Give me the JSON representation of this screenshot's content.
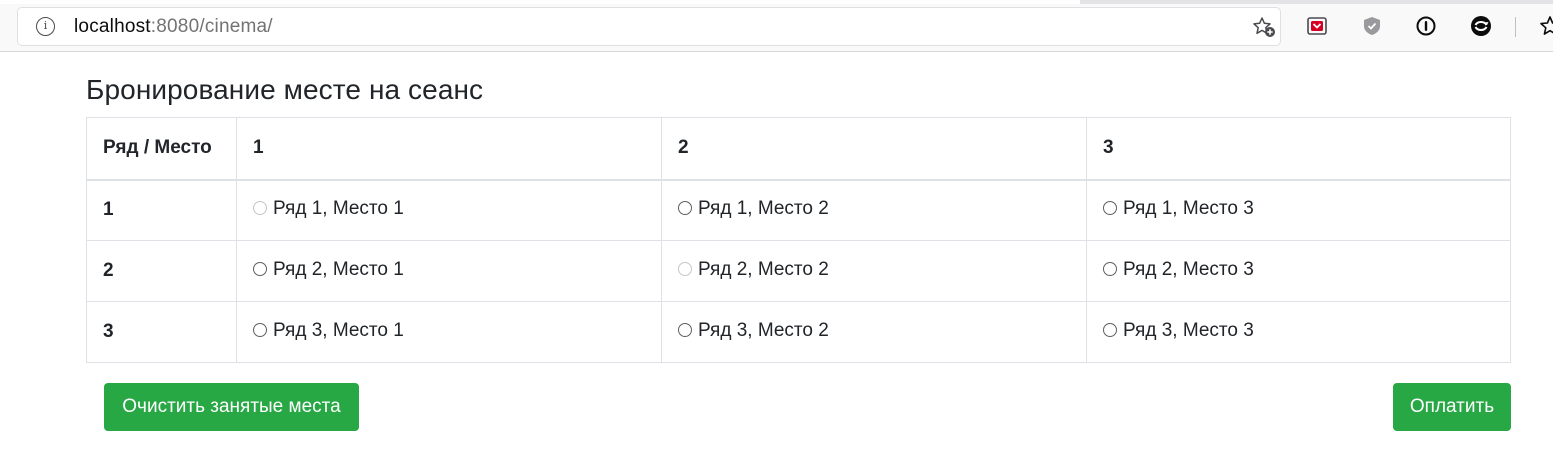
{
  "browser": {
    "url_host": "localhost",
    "url_rest": ":8080/cinema/",
    "icons": [
      "info-icon",
      "bookmark-star-icon",
      "pocket-icon",
      "shield-icon",
      "password-icon",
      "sync-icon",
      "bookmarks-star-icon"
    ]
  },
  "page": {
    "title": "Бронирование месте на сеанс"
  },
  "table": {
    "corner_header": "Ряд / Место",
    "columns": [
      "1",
      "2",
      "3"
    ],
    "rows": [
      {
        "label": "1",
        "seats": [
          {
            "text": "Ряд 1, Место 1",
            "disabled": true
          },
          {
            "text": "Ряд 1, Место 2",
            "disabled": false
          },
          {
            "text": "Ряд 1, Место 3",
            "disabled": false
          }
        ]
      },
      {
        "label": "2",
        "seats": [
          {
            "text": "Ряд 2, Место 1",
            "disabled": false
          },
          {
            "text": "Ряд 2, Место 2",
            "disabled": true
          },
          {
            "text": "Ряд 2, Место 3",
            "disabled": false
          }
        ]
      },
      {
        "label": "3",
        "seats": [
          {
            "text": "Ряд 3, Место 1",
            "disabled": false
          },
          {
            "text": "Ряд 3, Место 2",
            "disabled": false
          },
          {
            "text": "Ряд 3, Место 3",
            "disabled": false
          }
        ]
      }
    ]
  },
  "buttons": {
    "clear_label": "Очистить занятые места",
    "pay_label": "Оплатить"
  },
  "colors": {
    "button_green": "#28a745",
    "table_border": "#dee2e6",
    "text": "#212529"
  }
}
